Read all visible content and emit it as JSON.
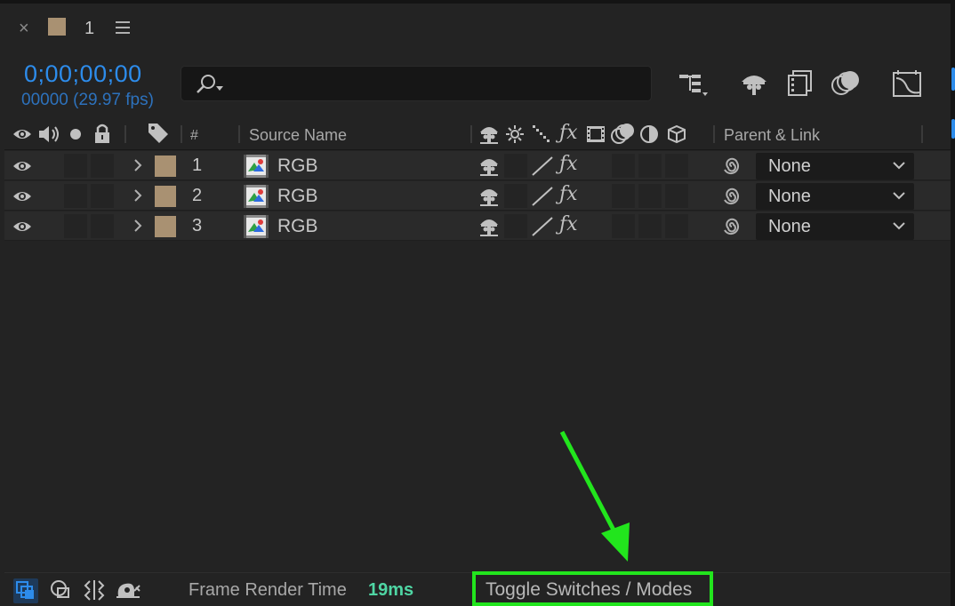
{
  "tab": {
    "close": "×",
    "name": "1"
  },
  "time": {
    "timecode": "0;00;00;00",
    "frames": "00000 (29.97 fps)"
  },
  "search": {
    "value": "",
    "placeholder": ""
  },
  "columns": {
    "number": "#",
    "source_name": "Source Name",
    "parent_link": "Parent & Link"
  },
  "layers": [
    {
      "number": "1",
      "name": "RGB",
      "parent": "None"
    },
    {
      "number": "2",
      "name": "RGB",
      "parent": "None"
    },
    {
      "number": "3",
      "name": "RGB",
      "parent": "None"
    }
  ],
  "footer": {
    "frame_render_label": "Frame Render Time",
    "frame_render_value": "19ms",
    "toggle_label": "Toggle Switches / Modes"
  },
  "colors": {
    "timecode": "#2d8ceb",
    "label_swatch": "#a99172",
    "render_time": "#4fd6a4",
    "highlight": "#22e51d"
  },
  "icons": [
    "close-icon",
    "menu-icon",
    "search-icon",
    "eye-icon",
    "audio-icon",
    "solo-icon",
    "lock-icon",
    "label-tag-icon",
    "shy-icon",
    "collapse-icon",
    "quality-icon",
    "effects-icon",
    "frame-blend-icon",
    "motion-blur-icon",
    "adjustment-icon",
    "3d-layer-icon",
    "pickwhip-icon",
    "arrow-annotation"
  ]
}
